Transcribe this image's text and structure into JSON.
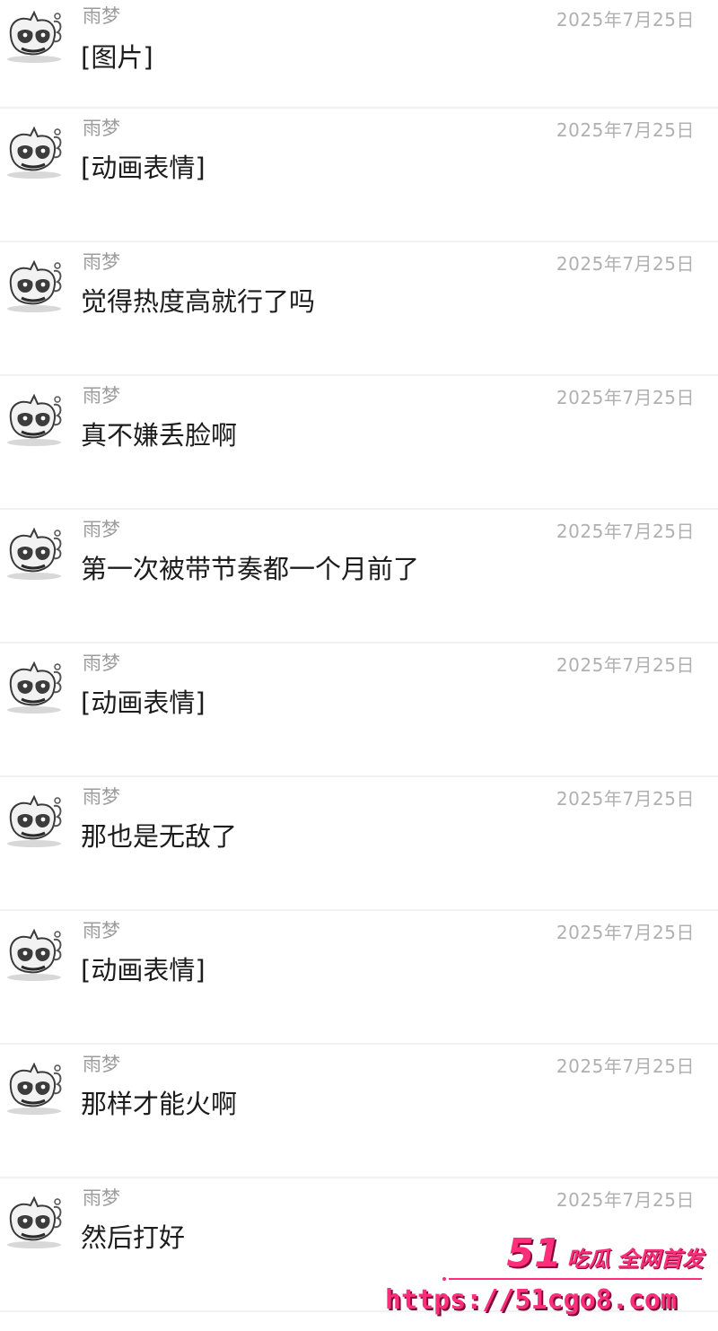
{
  "messages": [
    {
      "sender": "雨梦",
      "time": "2025年7月25日",
      "text": "[图片]"
    },
    {
      "sender": "雨梦",
      "time": "2025年7月25日",
      "text": "[动画表情]"
    },
    {
      "sender": "雨梦",
      "time": "2025年7月25日",
      "text": "觉得热度高就行了吗"
    },
    {
      "sender": "雨梦",
      "time": "2025年7月25日",
      "text": "真不嫌丢脸啊"
    },
    {
      "sender": "雨梦",
      "time": "2025年7月25日",
      "text": "第一次被带节奏都一个月前了"
    },
    {
      "sender": "雨梦",
      "time": "2025年7月25日",
      "text": "[动画表情]"
    },
    {
      "sender": "雨梦",
      "time": "2025年7月25日",
      "text": "那也是无敌了"
    },
    {
      "sender": "雨梦",
      "time": "2025年7月25日",
      "text": "[动画表情]"
    },
    {
      "sender": "雨梦",
      "time": "2025年7月25日",
      "text": "那样才能火啊"
    },
    {
      "sender": "雨梦",
      "time": "2025年7月25日",
      "text": "然后打好"
    }
  ],
  "watermark": {
    "number": "51",
    "slogan": "吃瓜 全网首发",
    "url": "https://51cgo8.com",
    "color": "#ff2e7a"
  },
  "icons": {
    "avatar": "cartoon-cat-avatar-icon"
  }
}
